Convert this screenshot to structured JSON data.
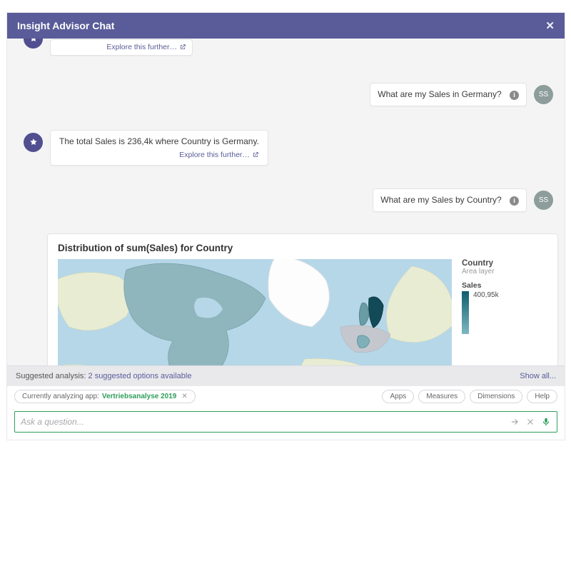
{
  "header": {
    "title": "Insight Advisor Chat"
  },
  "explore_label": "Explore this further…",
  "user_avatar": "SS",
  "messages": {
    "q1": "What are my Sales in Germany?",
    "a1": "The total Sales is 236,4k where Country is Germany.",
    "q2": "What are my Sales by Country?"
  },
  "viz": {
    "title": "Distribution of sum(Sales) for Country",
    "legend_title": "Country",
    "legend_sub": "Area layer",
    "measure": "Sales",
    "scale_max": "400,95k"
  },
  "suggest": {
    "prefix": "Suggested analysis: ",
    "link": "2 suggested options available",
    "showall": "Show all..."
  },
  "context": {
    "analyzing_prefix": "Currently analyzing app: ",
    "app_name": "Vertriebsanalyse 2019"
  },
  "chips": {
    "apps": "Apps",
    "measures": "Measures",
    "dimensions": "Dimensions",
    "help": "Help"
  },
  "input": {
    "placeholder": "Ask a question..."
  },
  "chart_data": {
    "type": "heatmap",
    "title": "Distribution of sum(Sales) for Country",
    "measure": "Sales",
    "dimension": "Country",
    "scale_max_value": 400950,
    "scale_max_label": "400,95k",
    "note": "Choropleth world map; darker teal = higher Sales. Exact per-country values not labeled; Finland/Sweden region and North America shaded."
  }
}
